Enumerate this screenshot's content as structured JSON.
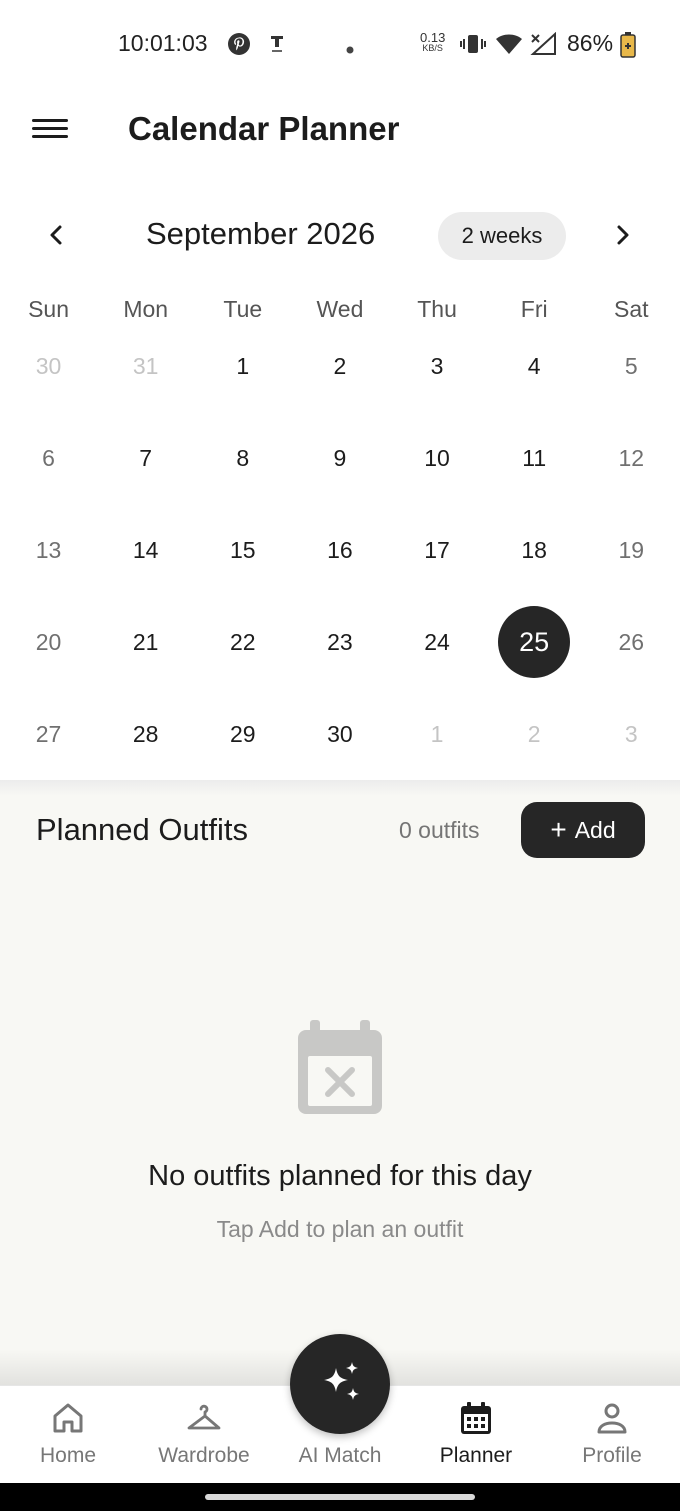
{
  "status_bar": {
    "time": "10:01:03",
    "net_speed_value": "0.13",
    "net_speed_unit": "KB/S",
    "battery": "86%"
  },
  "app_bar": {
    "title": "Calendar Planner",
    "menu_icon": "menu-icon"
  },
  "calendar": {
    "month_label": "September 2026",
    "range_chip": "2 weeks",
    "weekdays": [
      "Sun",
      "Mon",
      "Tue",
      "Wed",
      "Thu",
      "Fri",
      "Sat"
    ],
    "weeks": [
      [
        "30",
        "31",
        "1",
        "2",
        "3",
        "4",
        "5"
      ],
      [
        "6",
        "7",
        "8",
        "9",
        "10",
        "11",
        "12"
      ],
      [
        "13",
        "14",
        "15",
        "16",
        "17",
        "18",
        "19"
      ],
      [
        "20",
        "21",
        "22",
        "23",
        "24",
        "25",
        "26"
      ],
      [
        "27",
        "28",
        "29",
        "30",
        "1",
        "2",
        "3"
      ]
    ],
    "selected_day": "25"
  },
  "planned": {
    "title": "Planned Outfits",
    "count": "0 outfits",
    "add_label": "Add",
    "empty_title": "No outfits planned for this day",
    "empty_subtitle": "Tap Add to plan an outfit"
  },
  "bottom_nav": {
    "items": [
      {
        "label": "Home",
        "icon": "home-icon"
      },
      {
        "label": "Wardrobe",
        "icon": "hanger-icon"
      },
      {
        "label": "AI Match",
        "icon": "sparkles-icon"
      },
      {
        "label": "Planner",
        "icon": "calendar-icon"
      },
      {
        "label": "Profile",
        "icon": "person-icon"
      }
    ],
    "active": "Planner"
  },
  "colors": {
    "primary": "#262626",
    "section_bg": "#f8f8f4",
    "muted_text": "#757575",
    "chip_bg": "#ececec"
  }
}
